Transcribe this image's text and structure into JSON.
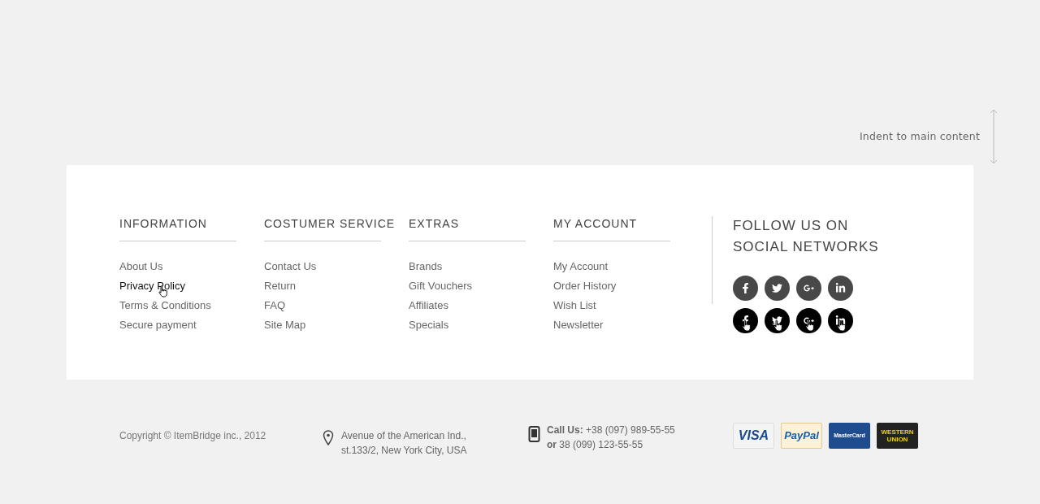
{
  "indent_note": "Indent to main content",
  "columns": [
    {
      "title": "INFORMATION",
      "links": [
        {
          "label": "About Us",
          "hovered": false
        },
        {
          "label": "Privacy Policy",
          "hovered": true
        },
        {
          "label": "Terms & Conditions",
          "hovered": false
        },
        {
          "label": "Secure payment",
          "hovered": false
        }
      ]
    },
    {
      "title": "COSTUMER SERVICE",
      "links": [
        {
          "label": "Contact Us",
          "hovered": false
        },
        {
          "label": "Return",
          "hovered": false
        },
        {
          "label": "FAQ",
          "hovered": false
        },
        {
          "label": "Site Map",
          "hovered": false
        }
      ]
    },
    {
      "title": "EXTRAS",
      "links": [
        {
          "label": "Brands",
          "hovered": false
        },
        {
          "label": "Gift Vouchers",
          "hovered": false
        },
        {
          "label": "Affiliates",
          "hovered": false
        },
        {
          "label": "Specials",
          "hovered": false
        }
      ]
    },
    {
      "title": "MY ACCOUNT",
      "links": [
        {
          "label": "My Account",
          "hovered": false
        },
        {
          "label": "Order History",
          "hovered": false
        },
        {
          "label": "Wish List",
          "hovered": false
        },
        {
          "label": "Newsletter",
          "hovered": false
        }
      ]
    }
  ],
  "social": {
    "title": "FOLLOW US ON SOCIAL NETWORKS",
    "rows": [
      [
        {
          "kind": "facebook",
          "hovered": false
        },
        {
          "kind": "twitter",
          "hovered": false
        },
        {
          "kind": "googleplus",
          "hovered": false
        },
        {
          "kind": "linkedin",
          "hovered": false
        }
      ],
      [
        {
          "kind": "facebook",
          "hovered": true
        },
        {
          "kind": "twitter",
          "hovered": true
        },
        {
          "kind": "googleplus",
          "hovered": true
        },
        {
          "kind": "linkedin",
          "hovered": true
        }
      ]
    ]
  },
  "bottom": {
    "copyright": "Copyright © ItemBridge inc., 2012",
    "address": [
      "Avenue of the American Ind.,",
      "st.133/2, New York City, USA"
    ],
    "phones": [
      "**Call Us:** +38 (097) 989-55-55",
      "**or** 38 (099) 123-55-55"
    ],
    "payments": [
      {
        "kind": "visa",
        "label": "VISA"
      },
      {
        "kind": "paypal",
        "label": "PayPal"
      },
      {
        "kind": "mastercard",
        "label": "MasterCard"
      },
      {
        "kind": "westernunion",
        "label": "WESTERN UNION"
      }
    ]
  }
}
